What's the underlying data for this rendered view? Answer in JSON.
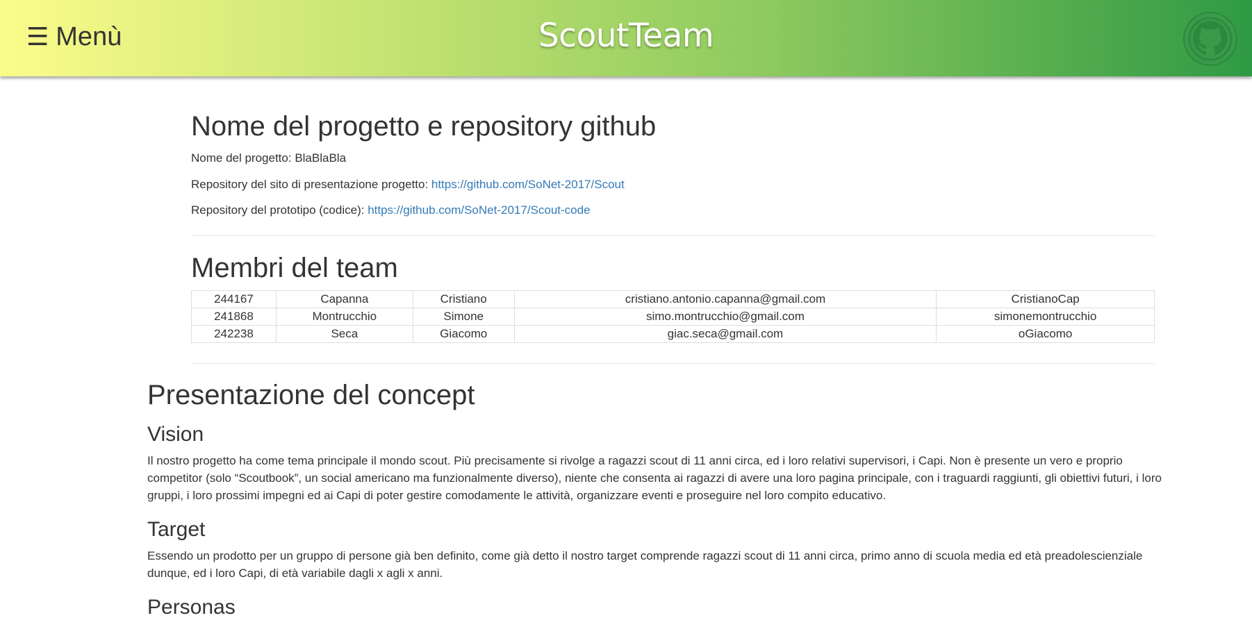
{
  "header": {
    "menu_label": "Menù",
    "menu_icon": "hamburger-icon",
    "title": "ScoutTeam",
    "github_icon": "github-icon",
    "gradient": [
      "#fbfc8a",
      "#2f9a44"
    ]
  },
  "project": {
    "heading": "Nome del progetto e repository github",
    "name_label": "Nome del progetto: ",
    "name_value": "BlaBlaBla",
    "site_repo_label": "Repository del sito di presentazione progetto: ",
    "site_repo_link": "https://github.com/SoNet-2017/Scout",
    "code_repo_label": "Repository del prototipo (codice): ",
    "code_repo_link": "https://github.com/SoNet-2017/Scout-code"
  },
  "team": {
    "heading": "Membri del team",
    "rows": [
      [
        "244167",
        "Capanna",
        "Cristiano",
        "cristiano.antonio.capanna@gmail.com",
        "CristianoCap"
      ],
      [
        "241868",
        "Montrucchio",
        "Simone",
        "simo.montrucchio@gmail.com",
        "simonemontrucchio"
      ],
      [
        "242238",
        "Seca",
        "Giacomo",
        "giac.seca@gmail.com",
        "oGiacomo"
      ]
    ]
  },
  "concept": {
    "heading": "Presentazione del concept",
    "vision_heading": "Vision",
    "vision_text": "Il nostro progetto ha come tema principale il mondo scout. Più precisamente si rivolge a ragazzi scout di 11 anni circa, ed i loro relativi supervisori, i Capi. Non è presente un vero e proprio competitor (solo “Scoutbook”, un social americano ma funzionalmente diverso), niente che consenta ai ragazzi di avere una loro pagina principale, con i traguardi raggiunti, gli obiettivi futuri, i loro gruppi, i loro prossimi impegni ed ai Capi di poter gestire comodamente le attività, organizzare eventi e proseguire nel loro compito educativo.",
    "target_heading": "Target",
    "target_text": "Essendo un prodotto per un gruppo di persone già ben definito, come già detto il nostro target comprende ragazzi scout di 11 anni circa, primo anno di scuola media ed età preadolescienziale dunque, ed i loro Capi, di età variabile dagli x agli x anni.",
    "personas_heading": "Personas"
  }
}
